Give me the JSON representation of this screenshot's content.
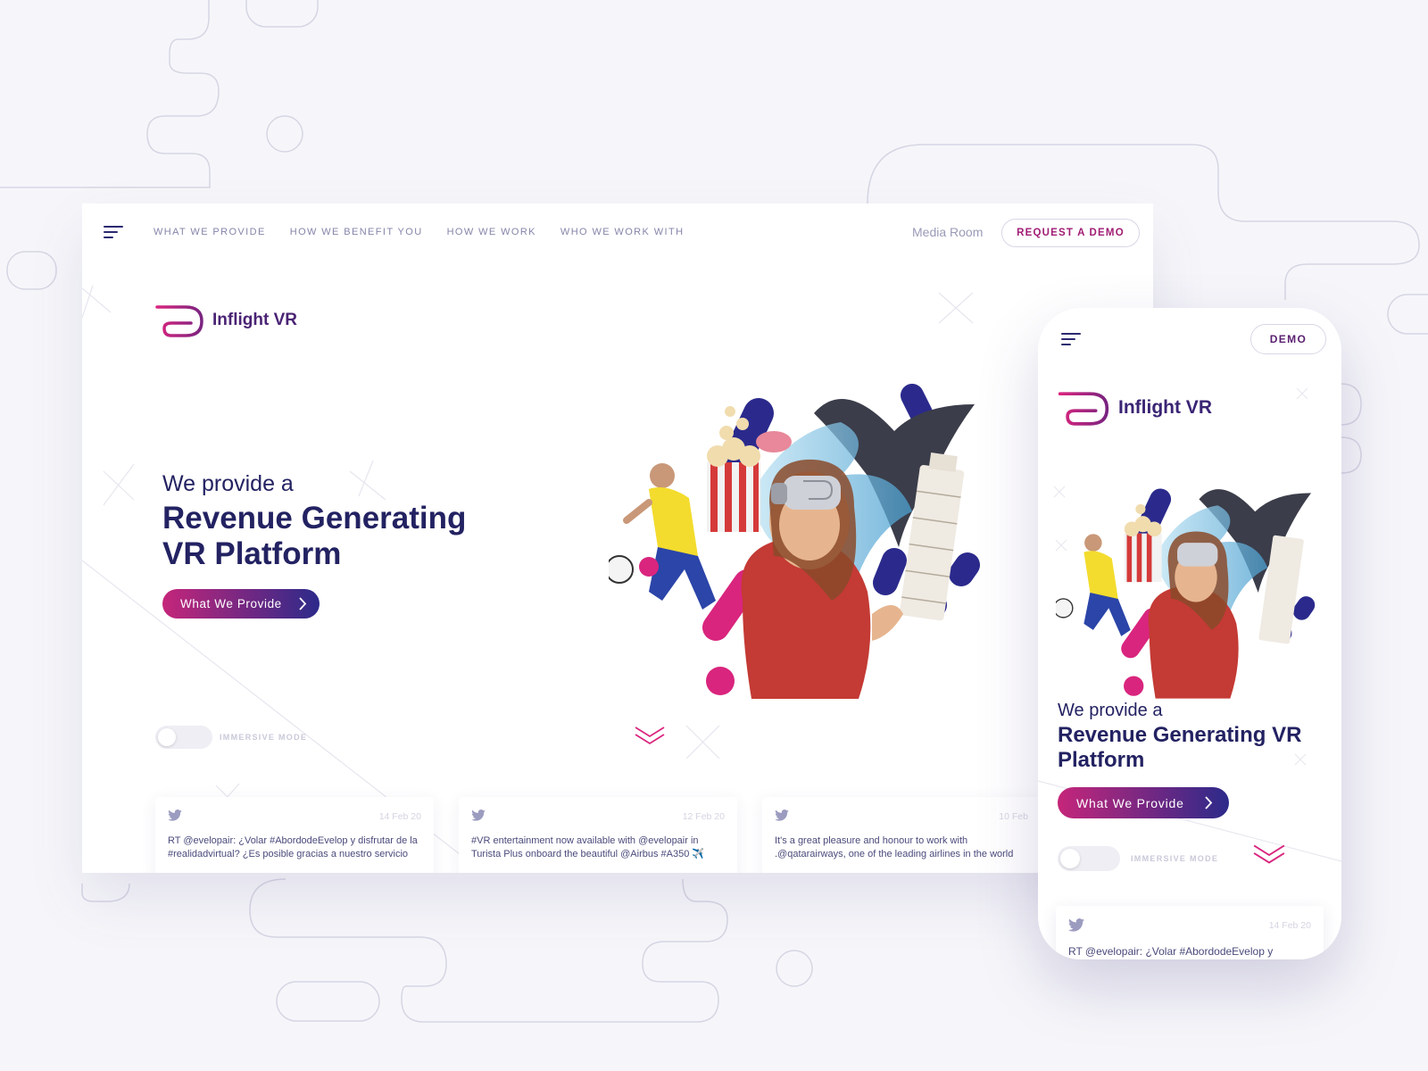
{
  "desktop": {
    "nav": {
      "links": [
        "WHAT WE PROVIDE",
        "HOW WE BENEFIT YOU",
        "HOW WE WORK",
        "WHO WE WORK WITH"
      ],
      "media_room": "Media Room",
      "demo_label": "REQUEST A DEMO"
    },
    "logo_text": "Inflight VR",
    "hero": {
      "pre": "We provide a",
      "main": "Revenue Generating VR Platform",
      "cta": "What We Provide"
    },
    "toggle_label": "IMMERSIVE MODE",
    "tweets": [
      {
        "date": "14 Feb 20",
        "text": "RT @evelopair: ¿Volar #AbordodeEvelop y disfrutar de la #realidadvirtual? ¿Es posible gracias a nuestro servicio"
      },
      {
        "date": "12 Feb 20",
        "text": "#VR entertainment now available with @evelopair in Turista Plus onboard the beautiful @Airbus #A350 ✈️"
      },
      {
        "date": "10 Feb",
        "text": "It's a great pleasure and honour to work with .@qatarairways, one of the leading airlines in the world"
      }
    ]
  },
  "mobile": {
    "demo_label": "DEMO",
    "logo_text": "Inflight VR",
    "hero": {
      "pre": "We provide a",
      "main": "Revenue Generating VR Platform",
      "cta": "What We Provide"
    },
    "toggle_label": "IMMERSIVE MODE",
    "tweet": {
      "date": "14 Feb 20",
      "text": "RT @evelopair: ¿Volar #AbordodeEvelop y"
    }
  },
  "colors": {
    "brand_magenta": "#c5267a",
    "brand_navy": "#232262",
    "brand_purple": "#4a2374",
    "accent_pink": "#d9257e",
    "accent_blue": "#2b2a8c"
  }
}
